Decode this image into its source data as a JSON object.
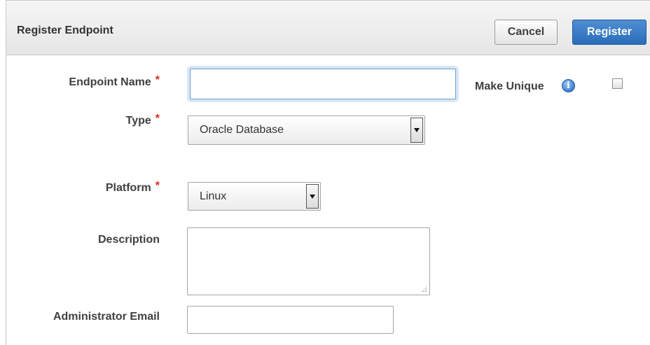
{
  "header": {
    "title": "Register Endpoint",
    "cancel_label": "Cancel",
    "register_label": "Register"
  },
  "form": {
    "endpoint_name": {
      "label": "Endpoint Name",
      "required_mark": "*",
      "value": ""
    },
    "make_unique": {
      "label": "Make Unique",
      "checked": false
    },
    "type": {
      "label": "Type",
      "required_mark": "*",
      "selected": "Oracle Database"
    },
    "platform": {
      "label": "Platform",
      "required_mark": "*",
      "selected": "Linux"
    },
    "description": {
      "label": "Description",
      "value": ""
    },
    "admin_email": {
      "label": "Administrator Email",
      "value": ""
    }
  },
  "icons": {
    "info": "info-icon",
    "dropdown": "chevron-down-icon"
  },
  "colors": {
    "required": "#e0281c",
    "primary_button": "#2a6db8",
    "focus_ring": "#d9e7f5"
  }
}
